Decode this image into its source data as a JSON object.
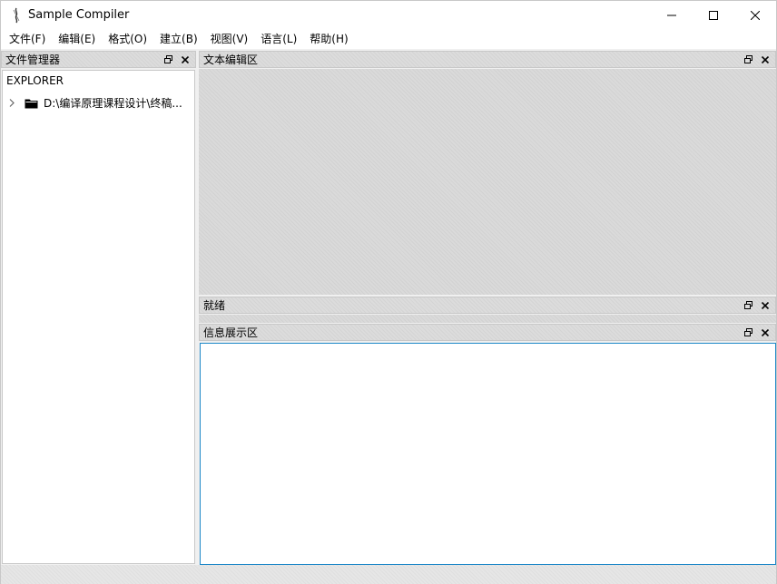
{
  "window": {
    "title": "Sample Compiler"
  },
  "menubar": {
    "items": [
      {
        "label": "文件(F)"
      },
      {
        "label": "编辑(E)"
      },
      {
        "label": "格式(O)"
      },
      {
        "label": "建立(B)"
      },
      {
        "label": "视图(V)"
      },
      {
        "label": "语言(L)"
      },
      {
        "label": "帮助(H)"
      }
    ]
  },
  "file_manager": {
    "title": "文件管理器",
    "explorer_label": "EXPLORER",
    "tree": [
      {
        "label": "D:\\编译原理课程设计\\终稿...",
        "icon": "folder-icon",
        "expanded": false
      }
    ]
  },
  "editor": {
    "title": "文本编辑区"
  },
  "status_panel": {
    "title": "就绪"
  },
  "info_panel": {
    "title": "信息展示区"
  },
  "colors": {
    "accent_border": "#1e88c8",
    "panel_header": "#dcdcdc",
    "background": "#f0f0f0"
  }
}
